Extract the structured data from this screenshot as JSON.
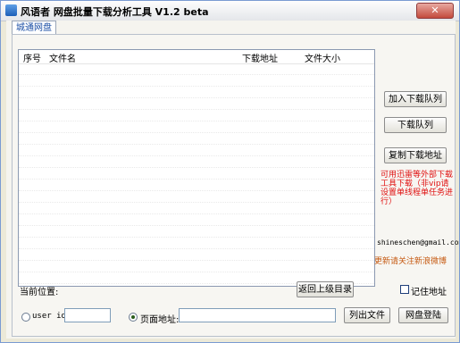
{
  "window": {
    "title": "风语者 网盘批量下载分析工具 V1.2 beta",
    "close_label": "✕"
  },
  "tabs": [
    {
      "label": "城通网盘",
      "selected": true
    }
  ],
  "list": {
    "columns": [
      "序号",
      "文件名",
      "下载地址",
      "文件大小"
    ],
    "rows": []
  },
  "buttons": {
    "add_queue": "加入下载队列",
    "download_queue": "下载队列",
    "copy_links": "复制下载地址",
    "go_up": "返回上级目录",
    "list_files": "列出文件",
    "login": "网盘登陆"
  },
  "hint_text": "可用迅雷等外部下载工具下载（非vip请设置单线程单任务进行）",
  "author_email": "shineschen@gmail.com",
  "follow_text": "更新请关注新浪微博",
  "current_location_label": "当前位置:",
  "remember_address_label": "记住地址",
  "remember_address_checked": false,
  "user_id": {
    "label": "user id:",
    "value": "",
    "selected": false
  },
  "page_address": {
    "label": "页面地址:",
    "value": "",
    "selected": true
  },
  "colors": {
    "hint": "#e01010",
    "follow": "#c65a12",
    "tab_text": "#1b4fa5"
  }
}
